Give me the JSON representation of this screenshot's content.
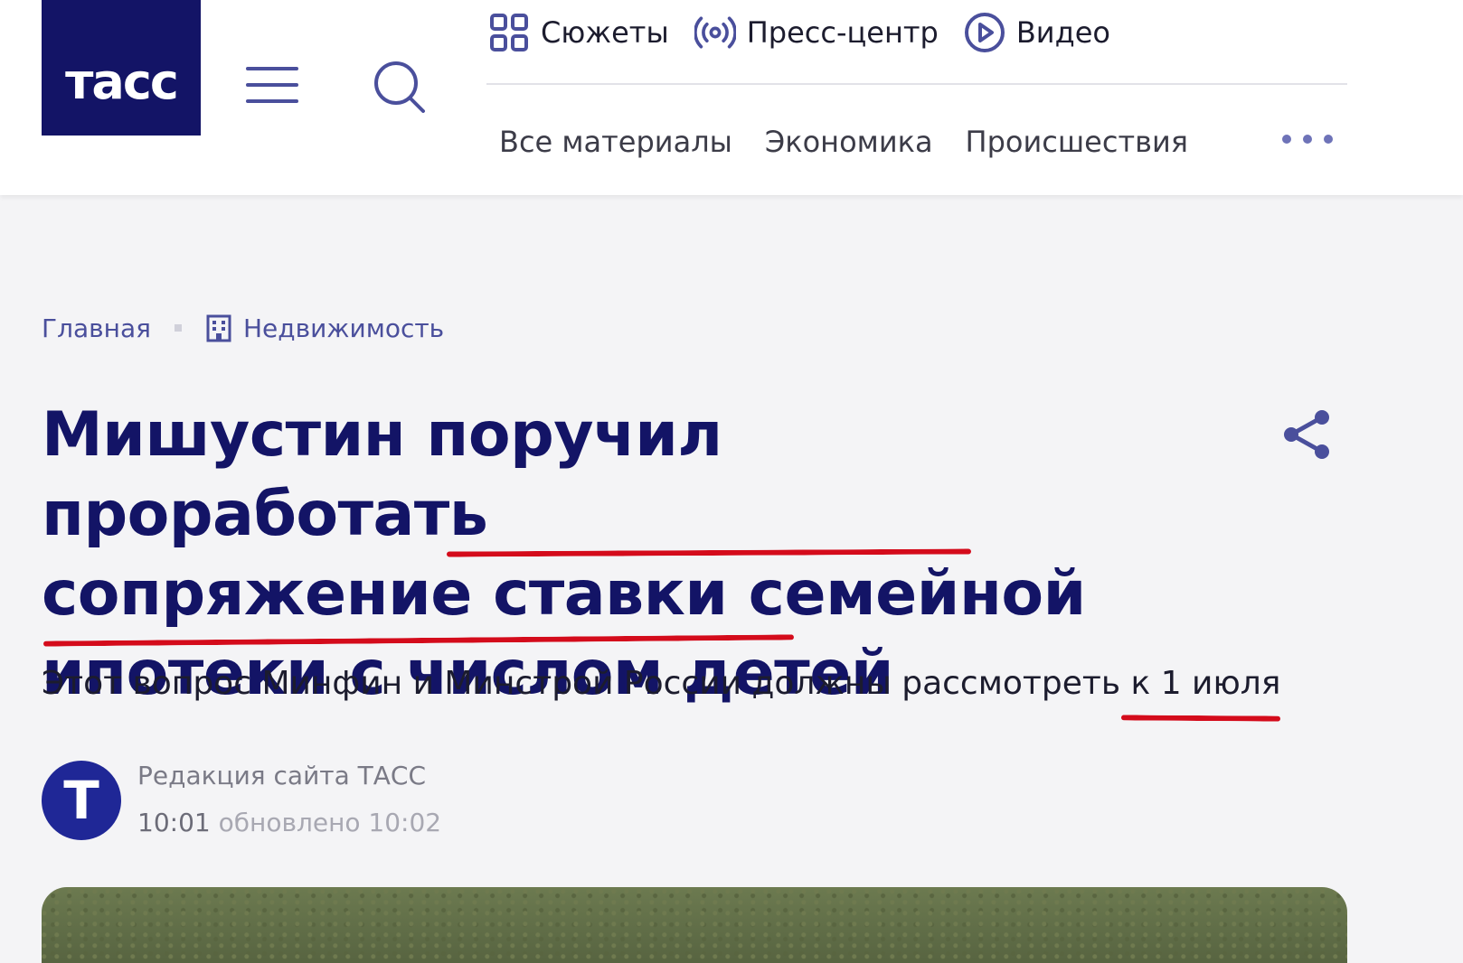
{
  "header": {
    "logo_text": "тасс",
    "top_nav": [
      {
        "label": "Сюжеты",
        "icon": "grid-icon"
      },
      {
        "label": "Пресс-центр",
        "icon": "broadcast-icon"
      },
      {
        "label": "Видео",
        "icon": "play-icon"
      }
    ],
    "categories": [
      "Все материалы",
      "Экономика",
      "Происшествия"
    ]
  },
  "breadcrumb": {
    "home": "Главная",
    "section": "Недвижимость"
  },
  "article": {
    "headline_line1": "Мишустин поручил проработать",
    "headline_line2_a": "сопряжение ",
    "headline_line2_b": "ставки семейной",
    "headline_line3": "ипотеки с числом детей",
    "subtitle_a": "Этот вопрос Минфин и Минстрой России должны рассмотреть ",
    "subtitle_b": "к 1 июля",
    "author": "Редакция сайта ТАСС",
    "avatar_letter": "Т",
    "time": "10:01",
    "updated": "обновлено 10:02"
  },
  "colors": {
    "brand_navy": "#131466",
    "accent_link": "#4a4f9c",
    "underline_red": "#d40b1b"
  }
}
